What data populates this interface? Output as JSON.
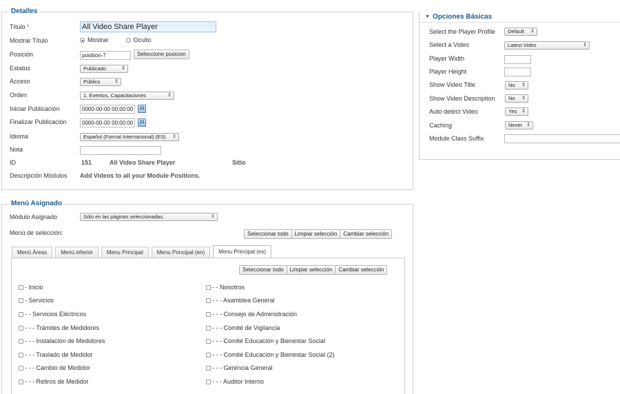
{
  "details": {
    "legend": "Detalles",
    "title_label": "Título",
    "title_required": "*",
    "title_value": "All Video Share Player",
    "show_title_label": "Mostrar Título",
    "show_option": "Mostrar",
    "hide_option": "Oculto",
    "position_label": "Posición",
    "position_value": "position-7",
    "position_button": "Seleccione posicion",
    "status_label": "Estatus",
    "status_value": "Publicado",
    "access_label": "Acceso",
    "access_value": "Público",
    "order_label": "Orden",
    "order_value": "1. Eventos, Capacitaciones",
    "publish_up_label": "Iniciar Publicación",
    "publish_up_value": "0000-00-00 00:00:00",
    "publish_down_label": "Finalizar Publicación",
    "publish_down_value": "0000-00-00 00:00:00",
    "calendar_icon_text": "23",
    "language_label": "Idioma",
    "language_value": "Español (Formal Internacional) (ES)",
    "note_label": "Nota",
    "note_value": "",
    "id_label": "ID",
    "id_value": "151",
    "module_name": "All Video Share Player",
    "site": "Sitio",
    "desc_label": "Descripción Módulos",
    "desc_value": "Add Videos to all your Module Positions."
  },
  "menu_assign": {
    "legend": "Menú Asignado",
    "module_assigned_label": "Módulo Asignado",
    "module_assigned_value": "Sólo en las páginas seleccionadas.",
    "selection_label": "Menú de selección:",
    "select_all": "Seleccionar todo",
    "clear_selection": "Limpiar selección",
    "toggle_selection": "Cambiar selección",
    "tabs": [
      "Menú Áreas",
      "Menú inferior",
      "Menu Principal",
      "Menu Principal (en)",
      "Menu Principal (es)"
    ],
    "left_items": [
      "- Inicio",
      "- Servicios",
      "- - Servicios Eléctricos",
      "- - - Trámites de Medidores",
      "- - - Instalación de Medidores",
      "- - - Traslado de Medidor",
      "- - - Cambio de Medidor",
      "- - - Retiros de Medidor"
    ],
    "right_items": [
      "- - Nosotros",
      "- - - Asamblea General",
      "- - - Consejo de Adminsitración",
      "- - - Comité de Vigilancia",
      "- - - Comité Educación y Bienestar Social",
      "- - - Comité Educación y Bienestar Social (2)",
      "- - - Gerencia General",
      "- - - Auditor Interno"
    ]
  },
  "basic_options": {
    "title": "Opciones Básicas",
    "profile_label": "Select the Player Profile",
    "profile_value": "Default",
    "video_label": "Select a Video",
    "video_value": "Latest Video",
    "width_label": "Player Width",
    "width_value": "",
    "height_label": "Player Height",
    "height_value": "",
    "show_title_label": "Show Video Title",
    "show_title_value": "No",
    "show_desc_label": "Show Video Description",
    "show_desc_value": "No",
    "auto_detect_label": "Auto detect Video",
    "auto_detect_value": "Yes",
    "caching_label": "Caching",
    "caching_value": "Never",
    "suffix_label": "Module Class Suffix",
    "suffix_value": ""
  },
  "icons": {
    "dropdown": "⇕",
    "collapse": "▼"
  }
}
